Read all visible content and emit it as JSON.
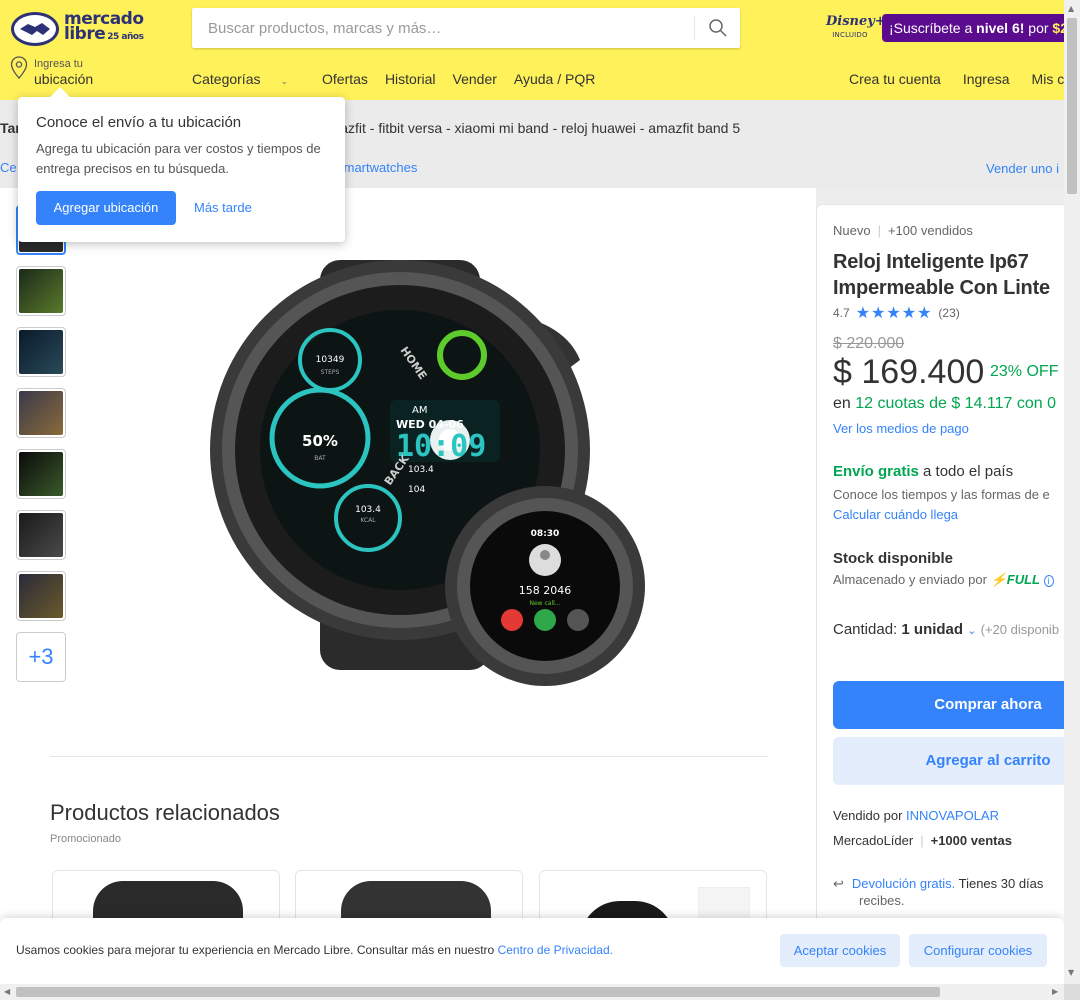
{
  "header": {
    "logo_line1": "mercado",
    "logo_line2": "libre",
    "logo_years": "25 años",
    "search_placeholder": "Buscar productos, marcas y más…",
    "disney_brand": "Disney+",
    "disney_sub": "INCLUIDO",
    "promo_text_1": "¡Suscríbete a ",
    "promo_text_bold": "nivel 6!",
    "promo_text_2": " por ",
    "promo_text_3": "$2",
    "location_line1": "Ingresa tu",
    "location_line2": "ubicación",
    "nav": [
      "Categorías",
      "Ofertas",
      "Historial",
      "Vender",
      "Ayuda / PQR"
    ],
    "nav_right": [
      "Crea tu cuenta",
      "Ingresa",
      "Mis co"
    ]
  },
  "subbar": {
    "related_prefix": "Tar",
    "related_text": "amazfit - fitbit versa - xiaomi mi band - reloj huawei - amazfit band 5",
    "breadcrumb_prefix": "Ce",
    "breadcrumb_text": "martwatches",
    "sell_link": "Vender uno i"
  },
  "popup": {
    "title": "Conoce el envío a tu ubicación",
    "body": "Agrega tu ubicación para ver costos y tiempos de entrega precisos en tu búsqueda.",
    "primary": "Agregar ubicación",
    "secondary": "Más tarde"
  },
  "gallery": {
    "more_label": "+3"
  },
  "watch": {
    "steps_value": "10349",
    "steps_label": "STEPS",
    "ampm": "AM",
    "date": "WED 04-06",
    "time": "10:09",
    "bat_value": "50%",
    "bat_label": "BAT",
    "stat1": "103.4",
    "stat2": "104",
    "kcal_value": "103.4",
    "kcal_label": "KCAL",
    "label_home": "HOME",
    "label_back": "BACK",
    "small_time": "08:30",
    "small_number": "158 2046",
    "small_caption": "New call..."
  },
  "related": {
    "title": "Productos relacionados",
    "subtitle": "Promocionado"
  },
  "product": {
    "condition": "Nuevo",
    "sold": "+100 vendidos",
    "title_line1": "Reloj Inteligente Ip67",
    "title_line2": "Impermeable Con Linte",
    "rating": "4.7",
    "stars": "★★★★★",
    "reviews": "(23)",
    "old_price": "$ 220.000",
    "price": "$ 169.400",
    "discount": "23% OFF",
    "cuotas_prefix": "en ",
    "cuotas_value": "12 cuotas de $ 14.117 con 0",
    "payment_link": "Ver los medios de pago",
    "shipping_free": "Envío gratis",
    "shipping_rest": " a todo el país",
    "shipping_info": "Conoce los tiempos y las formas de e",
    "shipping_calc": "Calcular cuándo llega",
    "stock": "Stock disponible",
    "stored": "Almacenado y enviado por",
    "full_label": "FULL",
    "qty_label": "Cantidad: ",
    "qty_value": "1 unidad",
    "qty_avail": "(+20 disponib",
    "buy_now": "Comprar ahora",
    "add_cart": "Agregar al carrito",
    "seller_prefix": "Vendido por ",
    "seller_name": "INNOVAPOLAR",
    "leader": "MercadoLíder",
    "sales": "+1000 ventas",
    "return_link": "Devolución gratis.",
    "return_rest": " Tienes 30 días",
    "return_line2": "recibes."
  },
  "cookie": {
    "text": "Usamos cookies para mejorar tu experiencia en Mercado Libre. Consultar más en nuestro ",
    "link": "Centro de Privacidad.",
    "accept": "Aceptar cookies",
    "configure": "Configurar cookies"
  },
  "colors": {
    "header_yellow": "#fff159",
    "brand_blue": "#3483fa",
    "green": "#00a650",
    "promo_purple": "#5b0c8e"
  }
}
